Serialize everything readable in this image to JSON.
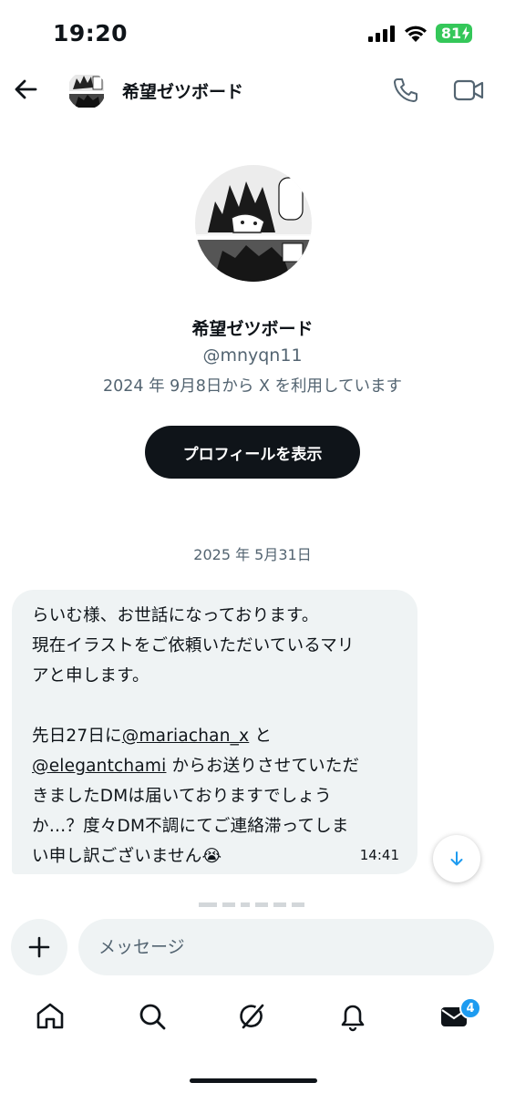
{
  "status_bar": {
    "time": "19:20",
    "battery": "81"
  },
  "header": {
    "title": "希望ゼツボード"
  },
  "profile": {
    "name": "希望ゼツボード",
    "handle": "@mnyqn11",
    "joined": "2024 年 9月8日から X を利用しています",
    "view_profile_label": "プロフィールを表示"
  },
  "conversation": {
    "date_separator": "2025 年 5月31日",
    "message": {
      "line1": "らいむ様、お世話になっております。",
      "line2": "現在イラストをご依頼いただいているマリ",
      "line3": "アと申します。",
      "pre_mention": "先日27日に",
      "mention1": "@mariachan_x",
      "post_mention1": " と",
      "mention2": "@elegantchami",
      "post_mention2": " からお送りさせていただ",
      "line6": "きましたDMは届いておりますでしょう",
      "line7": "か…？度々DM不調にてご連絡滞ってしま",
      "line8": "い申し訳ございません😭",
      "time": "14:41"
    }
  },
  "composer": {
    "placeholder": "メッセージ"
  },
  "tabbar": {
    "items": [
      "home-icon",
      "search-icon",
      "grok-icon",
      "notifications-icon",
      "messages-icon"
    ],
    "messages_badge": "4"
  },
  "colors": {
    "primary_text": "#0f1419",
    "secondary_text": "#536471",
    "bubble": "#eff3f4",
    "accent": "#1d9bf0",
    "battery": "#34c759"
  }
}
